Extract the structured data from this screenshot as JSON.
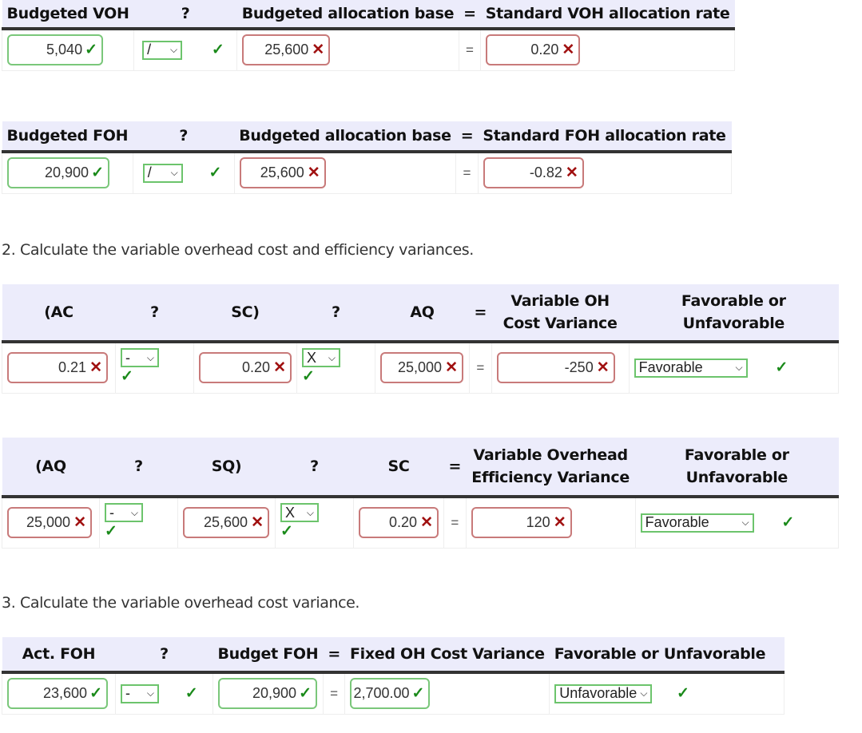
{
  "table1": {
    "headers": [
      "Budgeted VOH",
      "?",
      "Budgeted allocation base",
      "=",
      "Standard VOH allocation rate"
    ],
    "budgeted_voh": {
      "value": "5,040",
      "status": "correct"
    },
    "operator": {
      "value": "/",
      "status": "correct"
    },
    "allocation_base": {
      "value": "25,600",
      "status": "incorrect"
    },
    "equals": "=",
    "rate": {
      "value": "0.20",
      "status": "incorrect"
    }
  },
  "table2": {
    "headers": [
      "Budgeted FOH",
      "?",
      "Budgeted allocation base",
      "=",
      "Standard FOH allocation rate"
    ],
    "budgeted_foh": {
      "value": "20,900",
      "status": "correct"
    },
    "operator": {
      "value": "/",
      "status": "correct"
    },
    "allocation_base": {
      "value": "25,600",
      "status": "incorrect"
    },
    "equals": "=",
    "rate": {
      "value": "-0.82",
      "status": "incorrect"
    }
  },
  "prompt2": "2. Calculate the variable overhead cost and efficiency variances.",
  "table3": {
    "headers": [
      "(AC",
      "?",
      "SC)",
      "?",
      "AQ",
      "=",
      "Variable OH Cost Variance",
      "Favorable or Unfavorable"
    ],
    "ac": {
      "value": "0.21",
      "status": "incorrect"
    },
    "op1": {
      "value": "-",
      "status": "correct"
    },
    "sc": {
      "value": "0.20",
      "status": "incorrect"
    },
    "op2": {
      "value": "X",
      "status": "correct"
    },
    "aq": {
      "value": "25,000",
      "status": "incorrect"
    },
    "equals": "=",
    "variance": {
      "value": "-250",
      "status": "incorrect"
    },
    "fav": {
      "value": "Favorable",
      "status": "correct"
    }
  },
  "table4": {
    "headers": [
      "(AQ",
      "?",
      "SQ)",
      "?",
      "SC",
      "=",
      "Variable Overhead Efficiency Variance",
      "Favorable or Unfavorable"
    ],
    "aq": {
      "value": "25,000",
      "status": "incorrect"
    },
    "op1": {
      "value": "-",
      "status": "correct"
    },
    "sq": {
      "value": "25,600",
      "status": "incorrect"
    },
    "op2": {
      "value": "X",
      "status": "correct"
    },
    "sc": {
      "value": "0.20",
      "status": "incorrect"
    },
    "equals": "=",
    "variance": {
      "value": "120",
      "status": "incorrect"
    },
    "fav": {
      "value": "Favorable",
      "status": "correct"
    }
  },
  "prompt3": "3. Calculate the variable overhead cost variance.",
  "table5": {
    "headers": [
      "Act. FOH",
      "?",
      "Budget FOH",
      "=",
      "Fixed OH Cost Variance",
      "Favorable or Unfavorable"
    ],
    "act_foh": {
      "value": "23,600",
      "status": "correct"
    },
    "op": {
      "value": "-",
      "status": "correct"
    },
    "budget_foh": {
      "value": "20,900",
      "status": "correct"
    },
    "equals": "=",
    "variance": {
      "value": "2,700.00",
      "status": "correct"
    },
    "fav": {
      "value": "Unfavorable",
      "status": "correct"
    }
  },
  "marks": {
    "correct": "✓",
    "incorrect": "✕",
    "chevron": "⌄"
  },
  "colors": {
    "correct": "#1a8a1a",
    "incorrect": "#a01010",
    "header_bg": "#ececfb"
  }
}
